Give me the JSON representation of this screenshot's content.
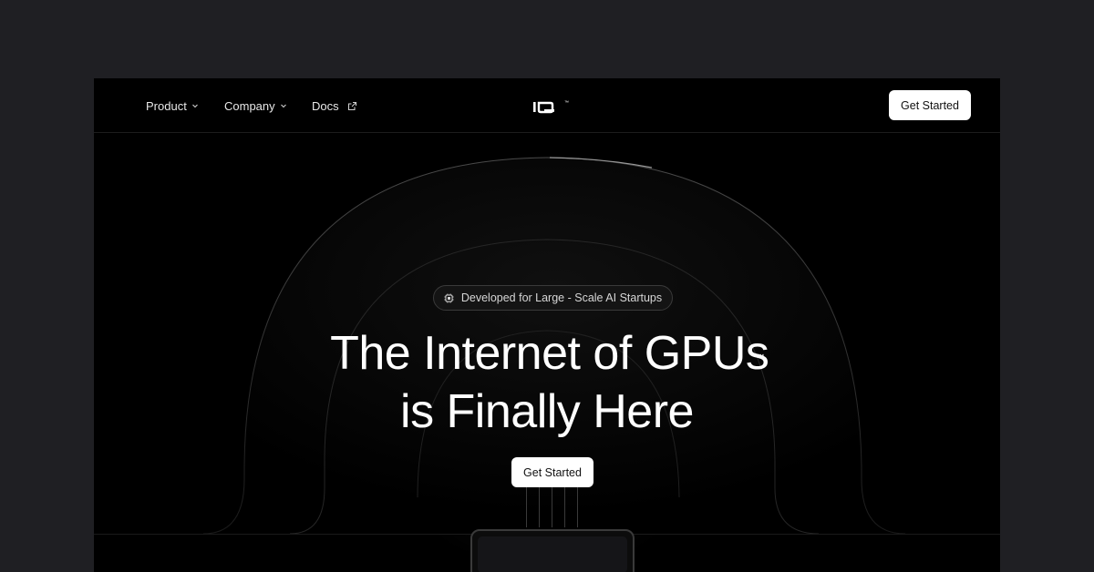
{
  "nav": {
    "items": [
      {
        "label": "Product",
        "icon": "chevron-down-icon"
      },
      {
        "label": "Company",
        "icon": "chevron-down-icon"
      },
      {
        "label": "Docs",
        "icon": "external-link-icon"
      }
    ],
    "logo_text": "io",
    "logo_mark": "™",
    "cta_label": "Get Started"
  },
  "hero": {
    "badge_icon": "chip-icon",
    "badge_label": "Developed for Large - Scale AI Startups",
    "headline_line1": "The Internet of GPUs",
    "headline_tm": "™",
    "headline_line2": "is Finally Here",
    "cta_label": "Get Started"
  },
  "colors": {
    "page_bg": "#1f1f23",
    "frame_bg": "#000000",
    "button_bg": "#ffffff",
    "button_text": "#111111"
  }
}
